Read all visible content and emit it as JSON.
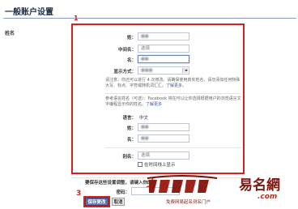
{
  "page": {
    "title": "一般账户设置",
    "section_label": "姓名"
  },
  "form": {
    "surname": {
      "label": "姓：",
      "value": ""
    },
    "middle_name": {
      "label": "中间名：",
      "value": "选填"
    },
    "given_name": {
      "label": "名：",
      "value": ""
    },
    "display_order": {
      "label": "显示方式：",
      "value": ""
    },
    "notice_text": "请注意：你还可以进行 4 次修改。请确保使用真实姓名，请勿添加任何特殊大写、标点、字符或随机词汇汇。",
    "notice_link": "了解更多。",
    "reference_text": "参考语言姓名（可选）：Facebook 将在可以让你选择根据用户的浏览语言文字编程显示你的姓名。",
    "reference_link": "了解更多",
    "language": {
      "label": "语言：",
      "value": "中文"
    },
    "ref_surname": {
      "label": "姓：",
      "value": ""
    },
    "ref_given_name": {
      "label": "名：",
      "value": ""
    },
    "alias": {
      "label": "别名：",
      "value": "选填"
    },
    "show_timeline_checkbox": "在时间线上显示",
    "confirm_text": "要保存这些设置调整，请键入你的",
    "password_label": "密码：",
    "save_button": "保存更改",
    "cancel_button": "取消"
  },
  "annotations": {
    "marker_1": "1",
    "marker_2": "2",
    "marker_3": "3",
    "accent_color": "#d42020"
  },
  "watermark": {
    "logo_text": "易名網",
    "subtitle": "免费网易起名测名门户",
    "url": ".com"
  }
}
